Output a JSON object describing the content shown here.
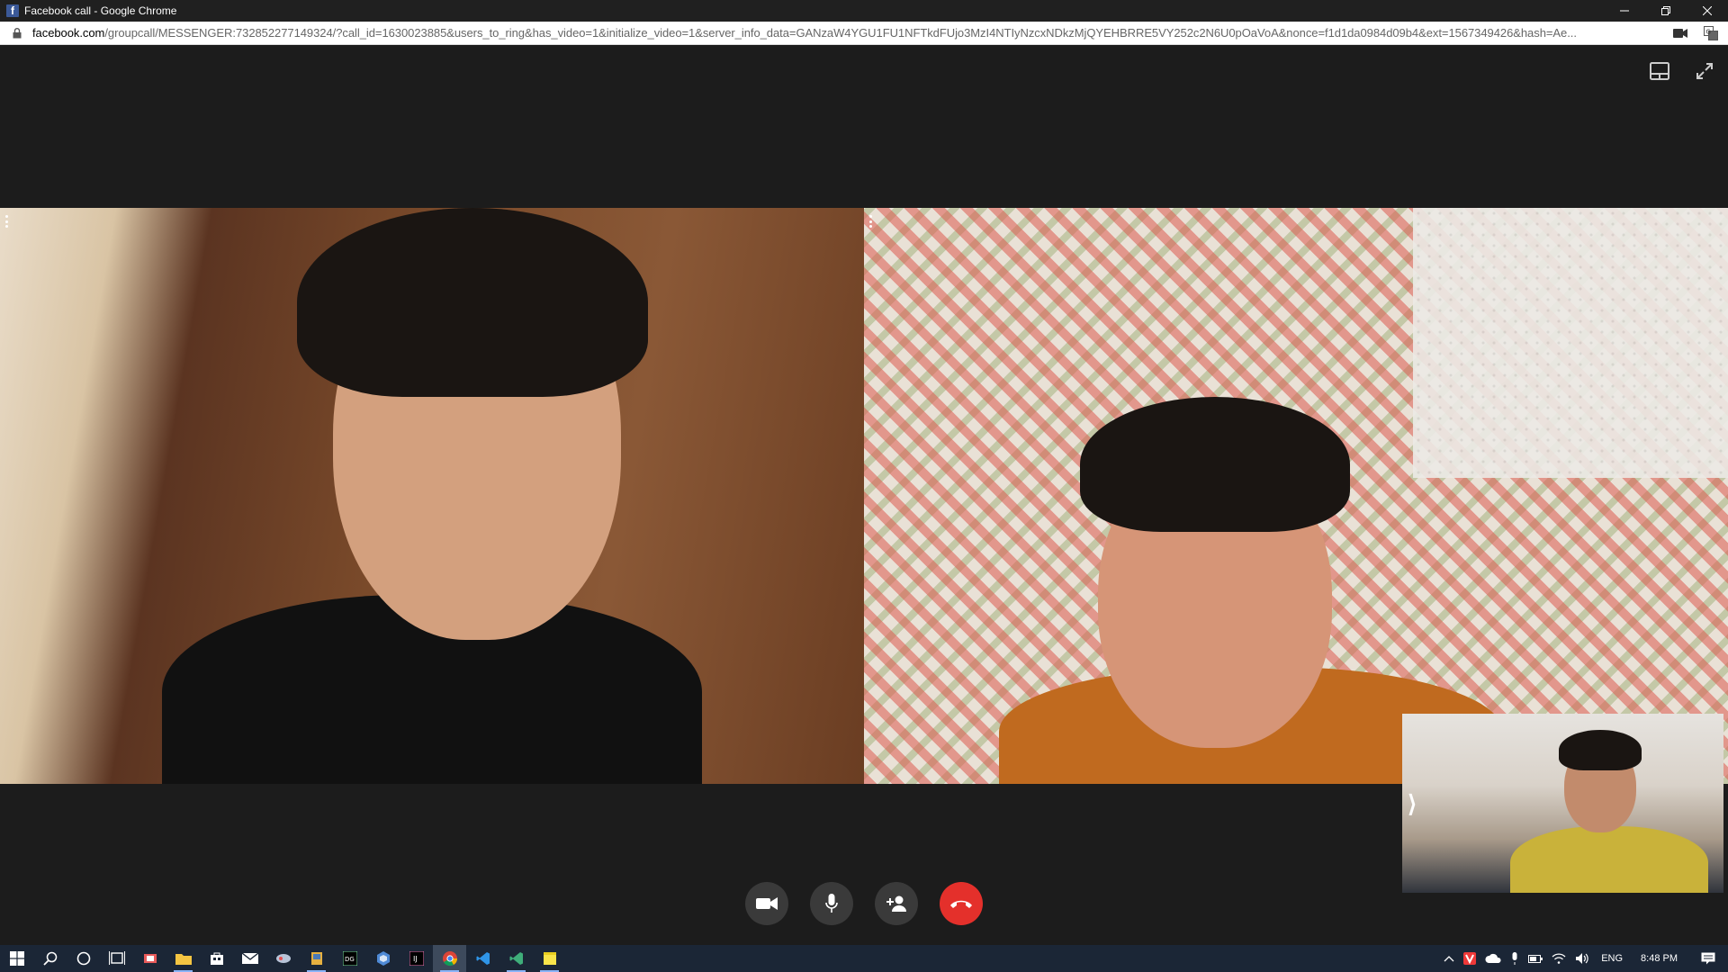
{
  "window": {
    "title": "Facebook call - Google Chrome",
    "favicon_icon": "facebook-icon",
    "buttons": [
      "minimize-icon",
      "restore-icon",
      "close-icon"
    ]
  },
  "address_bar": {
    "domain": "facebook.com",
    "path": "/groupcall/MESSENGER:732852277149324/?call_id=1630023885&users_to_ring&has_video=1&initialize_video=1&server_info_data=GANzaW4YGU1FU1NFTkdFUjo3MzI4NTIyNzcxNDkzMjQYEHBRRE5VY252c2N6U0pOaVoA&nonce=f1d1da0984d09b4&ext=1567349426&hash=Ae...",
    "icons": [
      "lock-icon",
      "camera-icon",
      "translate-icon"
    ]
  },
  "call": {
    "top_controls": [
      "layout-toggle-icon",
      "fullscreen-icon"
    ],
    "participants": 2,
    "self_view_chevron": "⟩",
    "controls": [
      {
        "name": "video-camera",
        "icon": "video-camera-icon"
      },
      {
        "name": "microphone",
        "icon": "microphone-icon"
      },
      {
        "name": "add-person",
        "icon": "add-person-icon"
      },
      {
        "name": "end-call",
        "icon": "phone-hangup-icon",
        "color": "#e4302b"
      }
    ]
  },
  "taskbar": {
    "icons": [
      "windows-start-icon",
      "search-icon",
      "cortana-icon",
      "task-view-icon",
      "app-icon-1",
      "file-explorer-icon",
      "store-icon",
      "mail-icon",
      "app-icon-2",
      "app-icon-3",
      "datagrip-icon",
      "app-icon-4",
      "intellij-icon",
      "chrome-icon",
      "vscode-icon",
      "vscode-insiders-icon",
      "sticky-notes-icon"
    ],
    "tray_icons": [
      "chevron-up-icon",
      "vivaldi-icon",
      "onedrive-icon",
      "microphone-icon",
      "battery-icon",
      "wifi-icon",
      "volume-icon"
    ],
    "language": "ENG",
    "time": "8:48 PM",
    "notification_icon": "action-center-icon"
  },
  "colors": {
    "background": "#1c1c1c",
    "end_call": "#e4302b",
    "taskbar": "#1b2636"
  }
}
